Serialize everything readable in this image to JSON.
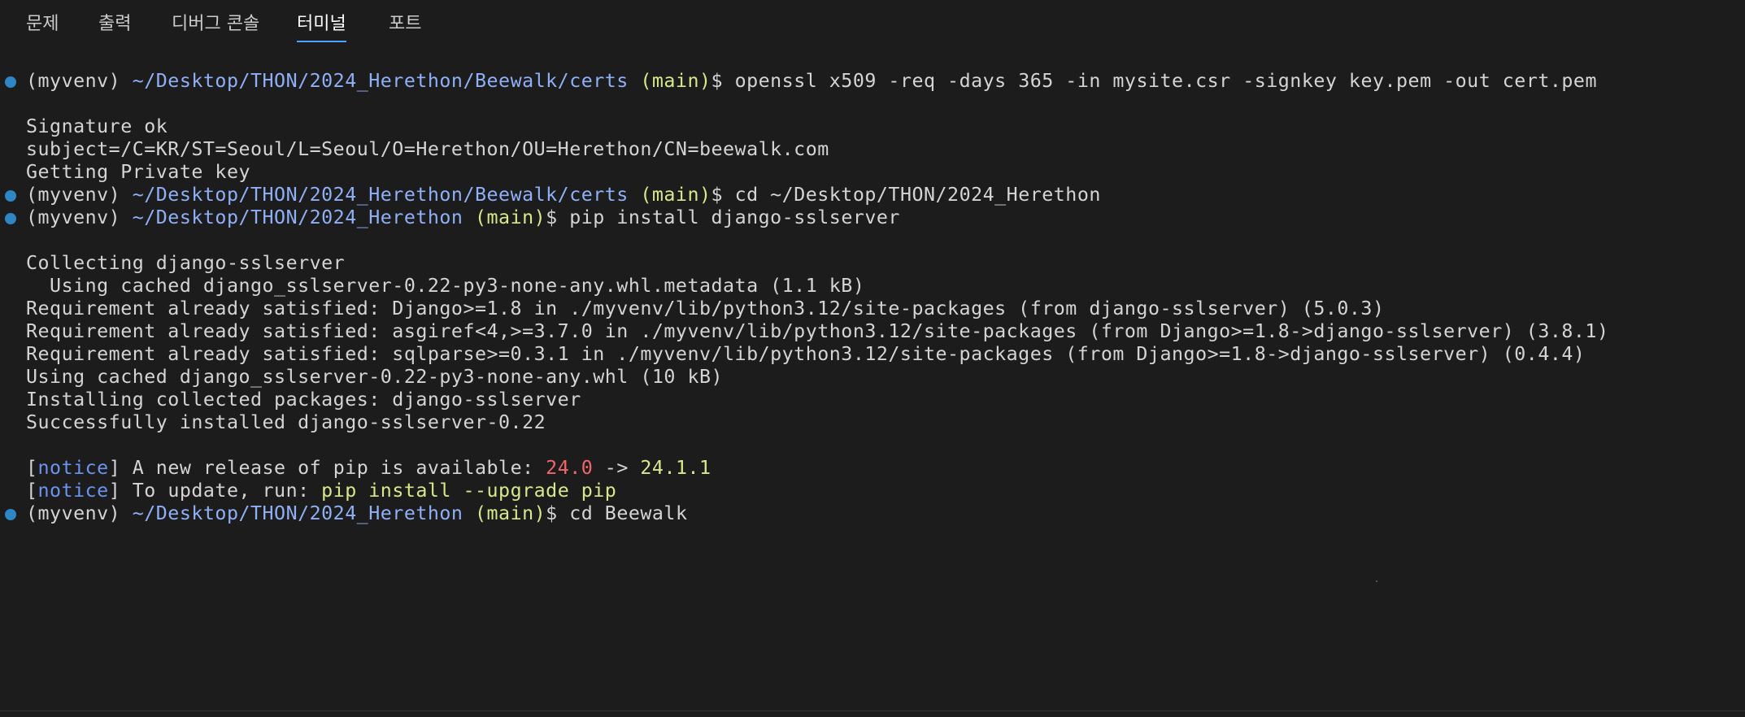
{
  "tabs": [
    {
      "label": "문제"
    },
    {
      "label": "출력"
    },
    {
      "label": "디버그 콘솔"
    },
    {
      "label": "터미널",
      "active": true
    },
    {
      "label": "포트"
    }
  ],
  "prompt": {
    "env": "(myvenv) ",
    "branch": " (main)",
    "dollar": "$ ",
    "path_certs": "~/Desktop/THON/2024_Herethon/Beewalk/certs",
    "path_root": "~/Desktop/THON/2024_Herethon"
  },
  "commands": {
    "openssl": "openssl x509 -req -days 365 -in mysite.csr -signkey key.pem -out cert.pem",
    "cd_root": "cd ~/Desktop/THON/2024_Herethon",
    "pip_install": "pip install django-sslserver",
    "cd_beewalk": "cd Beewalk"
  },
  "output": {
    "openssl": [
      "Signature ok",
      "subject=/C=KR/ST=Seoul/L=Seoul/O=Herethon/OU=Herethon/CN=beewalk.com",
      "Getting Private key"
    ],
    "pip": [
      "Collecting django-sslserver",
      "  Using cached django_sslserver-0.22-py3-none-any.whl.metadata (1.1 kB)",
      "Requirement already satisfied: Django>=1.8 in ./myvenv/lib/python3.12/site-packages (from django-sslserver) (5.0.3)",
      "Requirement already satisfied: asgiref<4,>=3.7.0 in ./myvenv/lib/python3.12/site-packages (from Django>=1.8->django-sslserver) (3.8.1)",
      "Requirement already satisfied: sqlparse>=0.3.1 in ./myvenv/lib/python3.12/site-packages (from Django>=1.8->django-sslserver) (0.4.4)",
      "Using cached django_sslserver-0.22-py3-none-any.whl (10 kB)",
      "Installing collected packages: django-sslserver",
      "Successfully installed django-sslserver-0.22"
    ]
  },
  "notice": {
    "open": "[",
    "tag": "notice",
    "close": "] ",
    "line1_text": "A new release of pip is available: ",
    "old_version": "24.0",
    "arrow": " -> ",
    "new_version": "24.1.1",
    "line2_text": "To update, run: ",
    "update_cmd": "pip install --upgrade pip"
  },
  "colors": {
    "background": "#1c1c1c",
    "text": "#d4d4d4",
    "path": "#8fb0f7",
    "branch": "#d6e98a",
    "notice_tag": "#6b93f0",
    "old_version": "#f0666a",
    "active_tab_underline": "#4da3ff",
    "prompt_dot": "#2f86c4"
  }
}
